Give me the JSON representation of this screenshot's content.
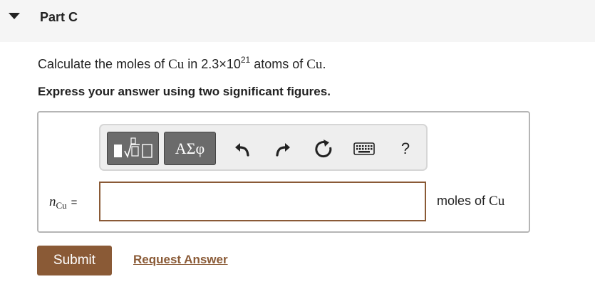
{
  "header": {
    "title": "Part C",
    "toggle_icon": "caret-down-icon"
  },
  "question": {
    "prefix": "Calculate the moles of ",
    "element_1": "Cu",
    "in_text": " in 2.3×10",
    "exponent": "21",
    "atoms_text": " atoms of ",
    "element_2": "Cu",
    "suffix": "."
  },
  "instruction": "Express your answer using two significant figures.",
  "toolbar": {
    "templates_icon": "templates-icon",
    "greek_label": "ΑΣφ",
    "undo_icon": "undo-icon",
    "redo_icon": "redo-icon",
    "reset_icon": "reset-icon",
    "keyboard_icon": "keyboard-icon",
    "help_label": "?"
  },
  "answer": {
    "variable": "n",
    "subscript": "Cu",
    "equals": "=",
    "value": "",
    "units_prefix": "moles of ",
    "units_element": "Cu"
  },
  "actions": {
    "submit_label": "Submit",
    "request_label": "Request Answer"
  },
  "colors": {
    "accent": "#8a5a36",
    "header_bg": "#f5f5f5",
    "toolbar_bg": "#eeeeee",
    "dark_button": "#6b6b6b"
  }
}
